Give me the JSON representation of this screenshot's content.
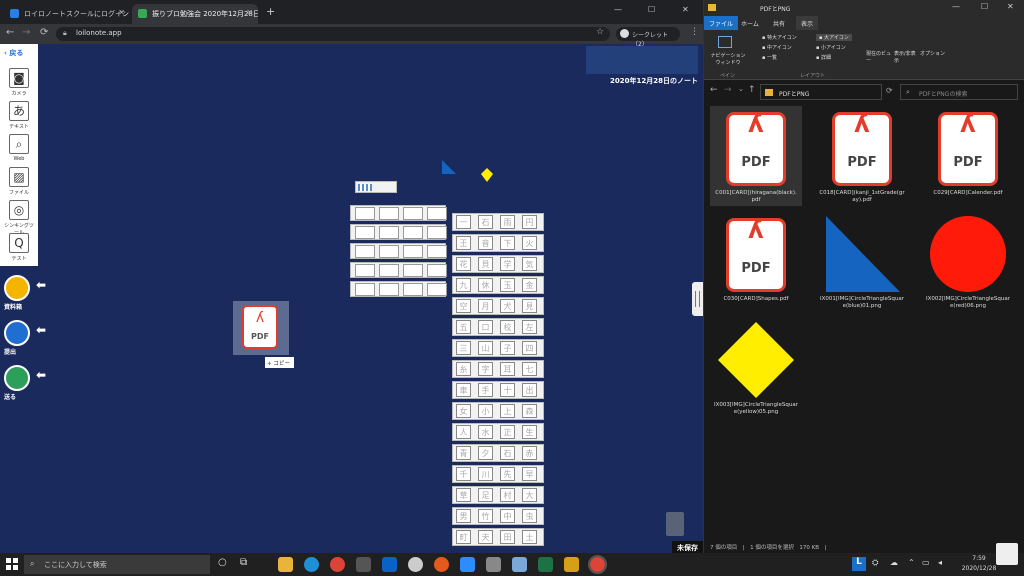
{
  "browser": {
    "tabs": [
      {
        "label": "ロイロノートスクールにログイン"
      },
      {
        "label": "振りブロ勉強会 2020年12月28日の"
      }
    ],
    "url": "loilonote.app",
    "incognito": "シークレット（2）",
    "note_title": "2020年12月28日のノート",
    "unsaved": "未保存",
    "copy_label": "コピー",
    "pdf_label": "PDF",
    "back_label": "戻る",
    "tools": [
      {
        "label": "カメラ",
        "glyph": "◙"
      },
      {
        "label": "テキスト",
        "glyph": "あ"
      },
      {
        "label": "Web",
        "glyph": "⌕"
      },
      {
        "label": "ファイル",
        "glyph": "▨"
      },
      {
        "label": "シンキングツール",
        "glyph": "◎"
      },
      {
        "label": "テスト",
        "glyph": "Q"
      }
    ],
    "side_buttons": [
      {
        "label": "資料箱"
      },
      {
        "label": "提出"
      },
      {
        "label": "送る"
      }
    ],
    "kanji_cells": [
      "一",
      "石",
      "雨",
      "円",
      "王",
      "音",
      "下",
      "火",
      "花",
      "貝",
      "学",
      "気",
      "九",
      "休",
      "玉",
      "金",
      "空",
      "月",
      "犬",
      "見",
      "五",
      "口",
      "校",
      "左",
      "三",
      "山",
      "子",
      "四",
      "糸",
      "字",
      "耳",
      "七",
      "車",
      "手",
      "十",
      "出",
      "女",
      "小",
      "上",
      "森",
      "人",
      "水",
      "正",
      "生",
      "青",
      "夕",
      "石",
      "赤",
      "千",
      "川",
      "先",
      "早",
      "草",
      "足",
      "村",
      "大",
      "男",
      "竹",
      "中",
      "虫",
      "町",
      "天",
      "田",
      "土"
    ]
  },
  "explorer": {
    "title": "PDFとPNG",
    "ribbon_tabs": [
      "ファイル",
      "ホーム",
      "共有",
      "表示"
    ],
    "ribbon": {
      "nav_pane": "ナビゲーション ウィンドウ",
      "pane_group": "ペイン",
      "layout_group": "レイアウト",
      "view_options": [
        "特大アイコン",
        "大アイコン",
        "中アイコン",
        "小アイコン",
        "一覧",
        "詳細"
      ],
      "current_view": "現在のビュー",
      "show_hide": "表示/非表示",
      "options": "オプション"
    },
    "path": "PDFとPNG",
    "search_placeholder": "PDFとPNGの検索",
    "files": [
      {
        "name": "C001[CARD](hiragana(black). pdf",
        "type": "pdf"
      },
      {
        "name": "C018[CARD](kanji_1stGrade(gr ay).pdf",
        "type": "pdf"
      },
      {
        "name": "C029[CARD]Calender.pdf",
        "type": "pdf"
      },
      {
        "name": "C030[CARD]Shapes.pdf",
        "type": "pdf"
      },
      {
        "name": "IX001[IMG]CircleTriangleSquar e(blue)01.png",
        "type": "triangle",
        "color": "#1565c0"
      },
      {
        "name": "IX002[IMG]CircleTriangleSquar e(red)06.png",
        "type": "circle",
        "color": "#ff1a0a"
      },
      {
        "name": "IX003[IMG]CircleTriangleSquar e(yellow)05.png",
        "type": "diamond",
        "color": "#ffee00"
      }
    ],
    "status": "7 個の項目　|　1 個の項目を選択　170 KB　|"
  },
  "taskbar": {
    "search_placeholder": "ここに入力して検索",
    "time": "7:59",
    "date": "2020/12/28"
  },
  "colors": {
    "canvas": "#1b2a5c",
    "pdf_red": "#e23c2a",
    "accent": "#1f6fd1"
  }
}
